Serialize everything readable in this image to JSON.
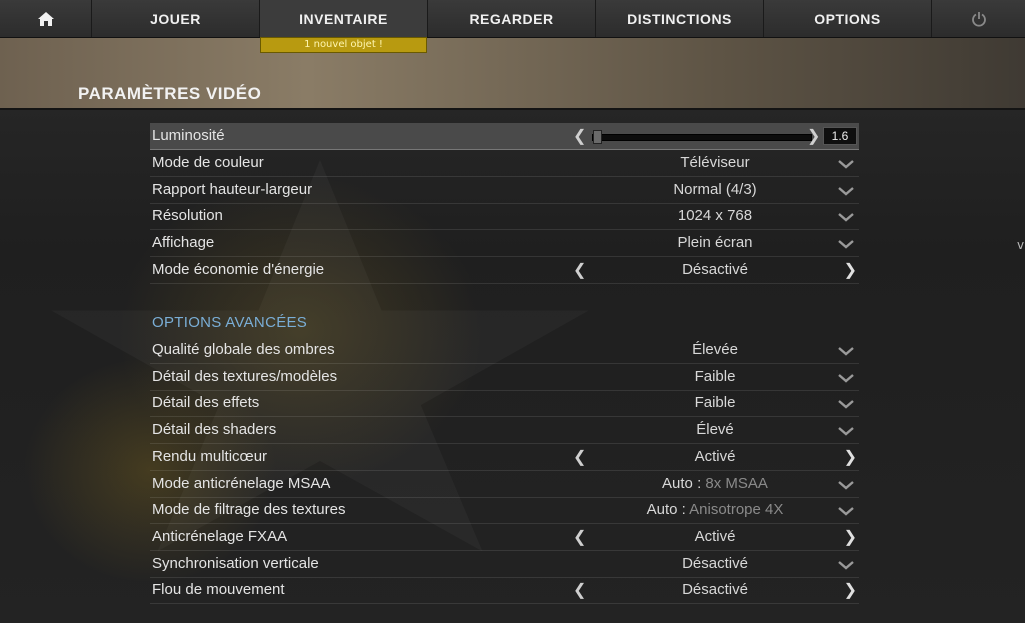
{
  "nav": {
    "home_icon": "home-icon",
    "items": [
      "JOUER",
      "INVENTAIRE",
      "REGARDER",
      "DISTINCTIONS",
      "OPTIONS"
    ],
    "power_icon": "power-icon",
    "notification": "1 nouvel objet !"
  },
  "page_title": "PARAMÈTRES VIDÉO",
  "brightness": {
    "label": "Luminosité",
    "value": "1.6",
    "level": 0.02
  },
  "basic_settings": [
    {
      "label": "Mode de couleur",
      "value": "Téléviseur",
      "control": "dropdown"
    },
    {
      "label": "Rapport hauteur-largeur",
      "value": "Normal (4/3)",
      "control": "dropdown"
    },
    {
      "label": "Résolution",
      "value": "1024 x 768",
      "control": "dropdown"
    },
    {
      "label": "Affichage",
      "value": "Plein écran",
      "control": "dropdown"
    },
    {
      "label": "Mode économie d'énergie",
      "value": "Désactivé",
      "control": "toggle"
    }
  ],
  "advanced_title": "OPTIONS AVANCÉES",
  "advanced_settings": [
    {
      "label": "Qualité globale des ombres",
      "value": "Élevée",
      "control": "dropdown"
    },
    {
      "label": "Détail des textures/modèles",
      "value": "Faible",
      "control": "dropdown"
    },
    {
      "label": "Détail des effets",
      "value": "Faible",
      "control": "dropdown"
    },
    {
      "label": "Détail des shaders",
      "value": "Élevé",
      "control": "dropdown"
    },
    {
      "label": "Rendu multicœur",
      "value": "Activé",
      "control": "toggle"
    },
    {
      "label": "Mode anticrénelage MSAA",
      "value_prefix": "Auto : ",
      "value_dim": "8x MSAA",
      "control": "dropdown"
    },
    {
      "label": "Mode de filtrage des textures",
      "value_prefix": "Auto : ",
      "value_dim": "Anisotrope 4X",
      "control": "dropdown"
    },
    {
      "label": "Anticrénelage FXAA",
      "value": "Activé",
      "control": "toggle"
    },
    {
      "label": "Synchronisation verticale",
      "value": "Désactivé",
      "control": "dropdown"
    },
    {
      "label": "Flou de mouvement",
      "value": "Désactivé",
      "control": "toggle"
    }
  ],
  "glyphs": {
    "left": "❮",
    "right": "❯",
    "edge": "v"
  },
  "colors": {
    "accent": "#7aaed6",
    "notification": "#b89a10"
  }
}
